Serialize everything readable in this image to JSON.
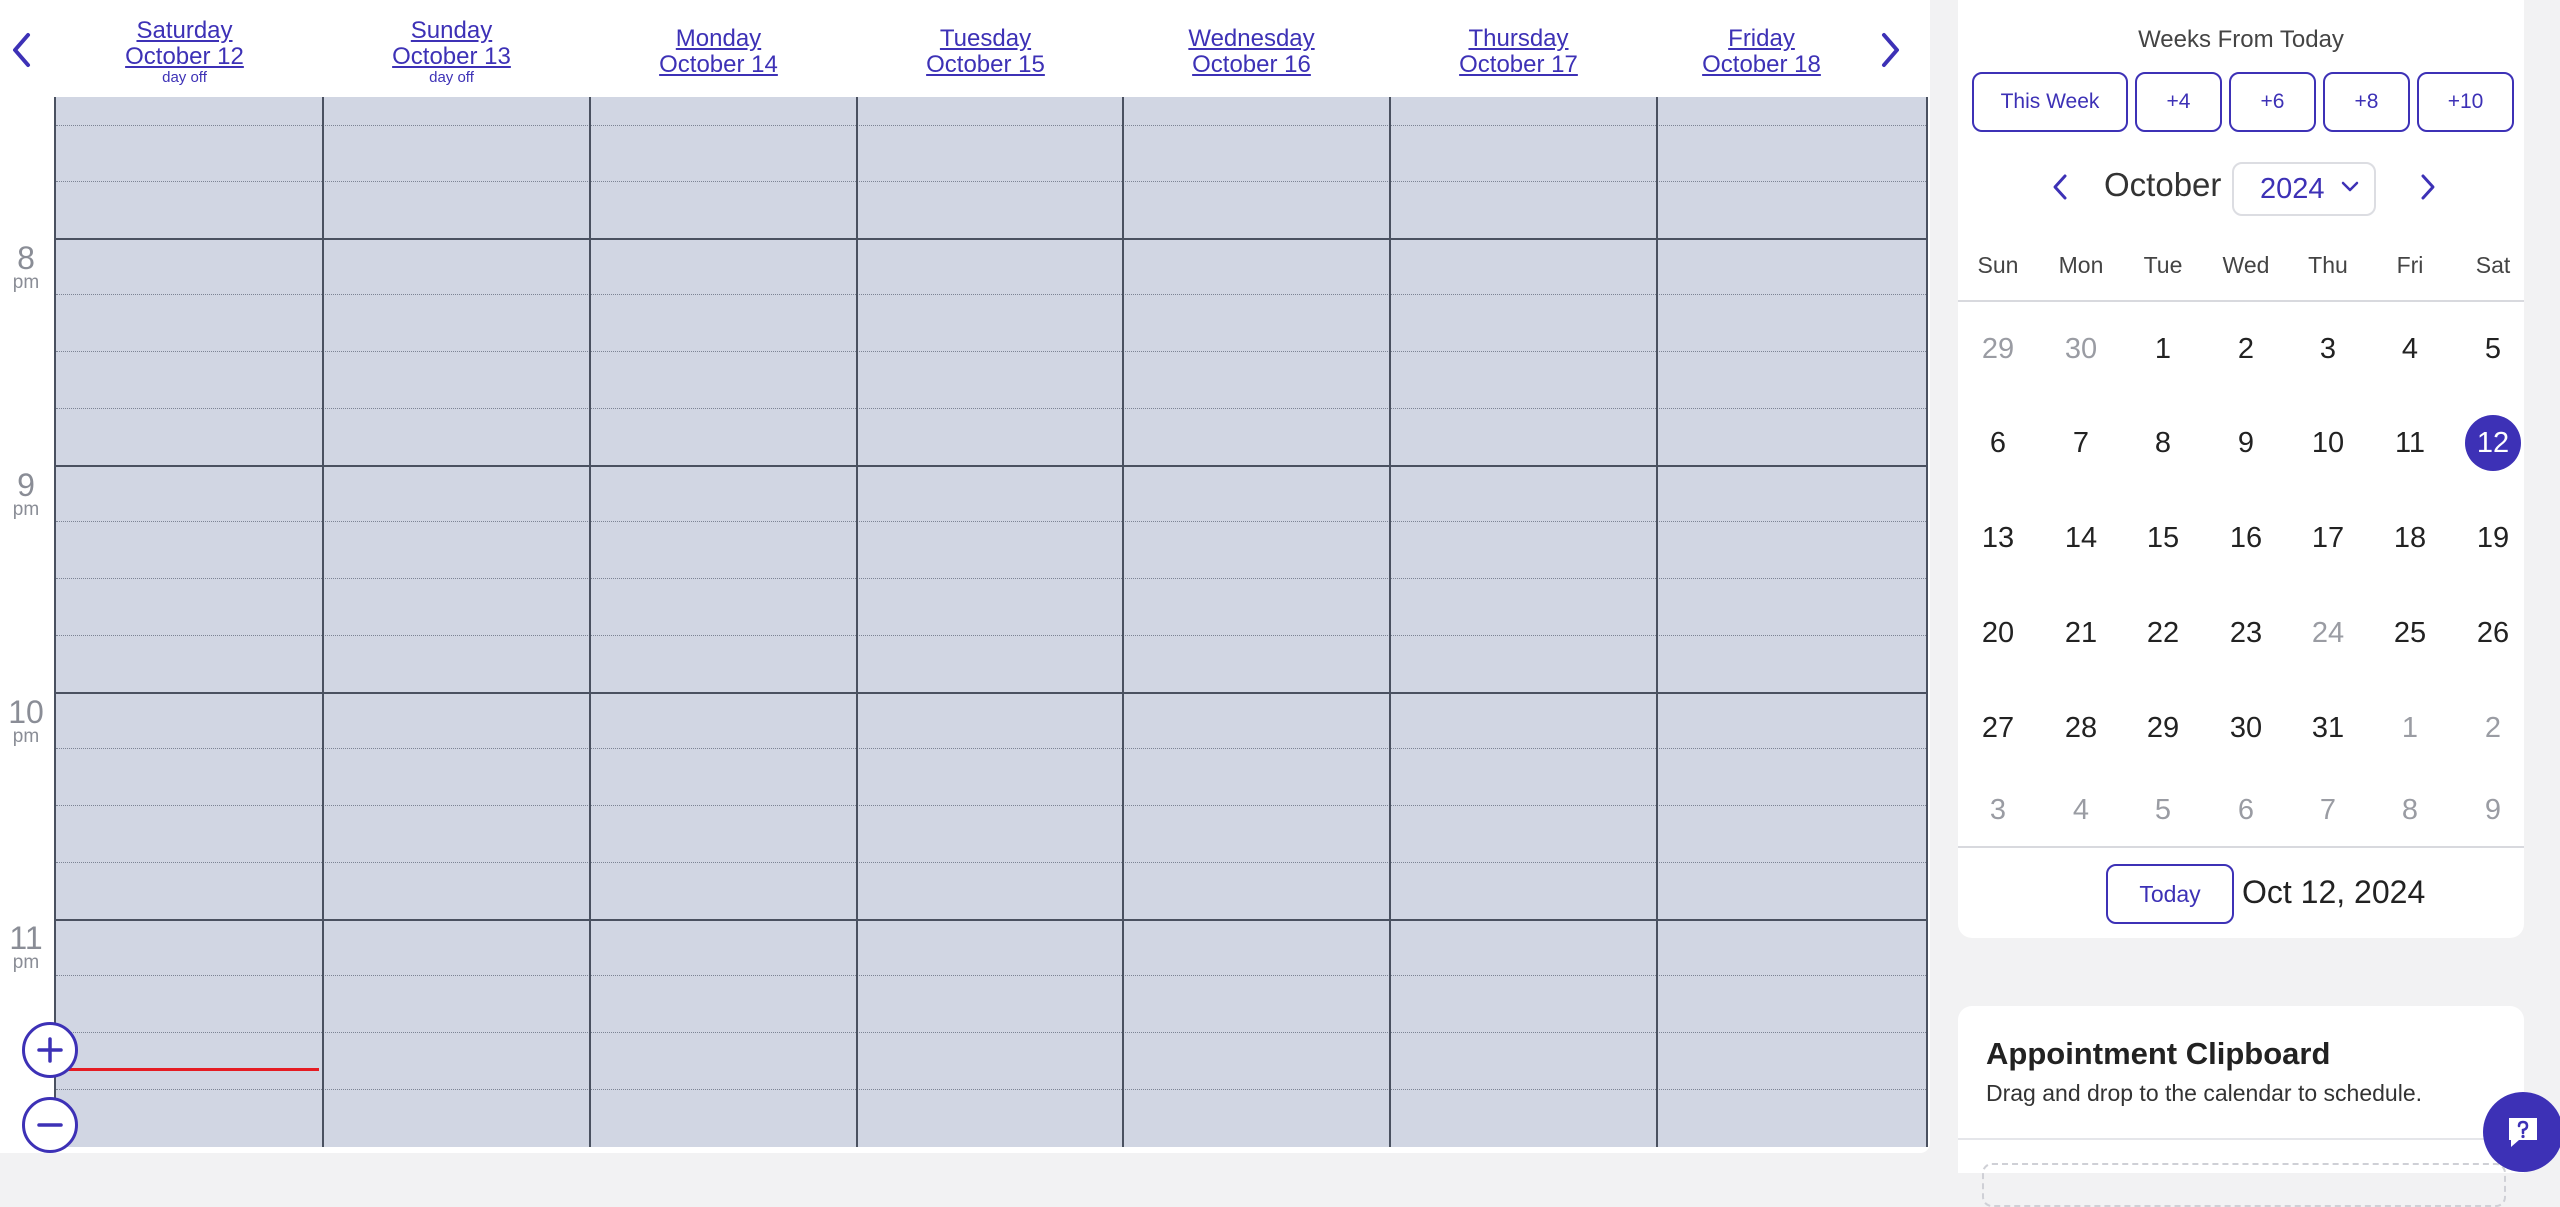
{
  "week_header": {
    "days": [
      {
        "weekday": "Saturday",
        "date": "October 12",
        "note": "day off"
      },
      {
        "weekday": "Sunday",
        "date": "October 13",
        "note": "day off"
      },
      {
        "weekday": "Monday",
        "date": "October 14",
        "note": ""
      },
      {
        "weekday": "Tuesday",
        "date": "October 15",
        "note": ""
      },
      {
        "weekday": "Wednesday",
        "date": "October 16",
        "note": ""
      },
      {
        "weekday": "Thursday",
        "date": "October 17",
        "note": ""
      },
      {
        "weekday": "Friday",
        "date": "October 18",
        "note": ""
      }
    ]
  },
  "time_labels": [
    {
      "hour": "8",
      "ampm": "pm"
    },
    {
      "hour": "9",
      "ampm": "pm"
    },
    {
      "hour": "10",
      "ampm": "pm"
    },
    {
      "hour": "11",
      "ampm": "pm"
    }
  ],
  "weeks_from_today": {
    "title": "Weeks From Today",
    "buttons": [
      "This Week",
      "+4",
      "+6",
      "+8",
      "+10"
    ]
  },
  "mini_calendar": {
    "month": "October",
    "year": "2024",
    "weekdays": [
      "Sun",
      "Mon",
      "Tue",
      "Wed",
      "Thu",
      "Fri",
      "Sat"
    ],
    "weeks": [
      [
        {
          "d": "29",
          "muted": true
        },
        {
          "d": "30",
          "muted": true
        },
        {
          "d": "1"
        },
        {
          "d": "2"
        },
        {
          "d": "3"
        },
        {
          "d": "4"
        },
        {
          "d": "5"
        }
      ],
      [
        {
          "d": "6"
        },
        {
          "d": "7"
        },
        {
          "d": "8"
        },
        {
          "d": "9"
        },
        {
          "d": "10"
        },
        {
          "d": "11"
        },
        {
          "d": "12",
          "selected": true
        }
      ],
      [
        {
          "d": "13"
        },
        {
          "d": "14"
        },
        {
          "d": "15"
        },
        {
          "d": "16"
        },
        {
          "d": "17"
        },
        {
          "d": "18"
        },
        {
          "d": "19"
        }
      ],
      [
        {
          "d": "20"
        },
        {
          "d": "21"
        },
        {
          "d": "22"
        },
        {
          "d": "23"
        },
        {
          "d": "24",
          "muted": true
        },
        {
          "d": "25"
        },
        {
          "d": "26"
        }
      ],
      [
        {
          "d": "27"
        },
        {
          "d": "28"
        },
        {
          "d": "29"
        },
        {
          "d": "30"
        },
        {
          "d": "31"
        },
        {
          "d": "1",
          "muted": true
        },
        {
          "d": "2",
          "muted": true
        }
      ],
      [
        {
          "d": "3",
          "muted": true
        },
        {
          "d": "4",
          "muted": true
        },
        {
          "d": "5",
          "muted": true
        },
        {
          "d": "6",
          "muted": true
        },
        {
          "d": "7",
          "muted": true
        },
        {
          "d": "8",
          "muted": true
        },
        {
          "d": "9",
          "muted": true
        }
      ]
    ],
    "today_label": "Today",
    "current_date": "Oct 12, 2024"
  },
  "clipboard": {
    "title": "Appointment Clipboard",
    "subtitle": "Drag and drop to the calendar to schedule."
  },
  "colors": {
    "accent": "#3d31b6",
    "grid_bg": "#d1d6e3",
    "now_line": "#e51c23"
  },
  "icons": {
    "prev_week": "chevron-left-icon",
    "next_week": "chevron-right-icon",
    "zoom_in": "plus-icon",
    "zoom_out": "minus-icon",
    "chat": "chat-help-icon"
  }
}
